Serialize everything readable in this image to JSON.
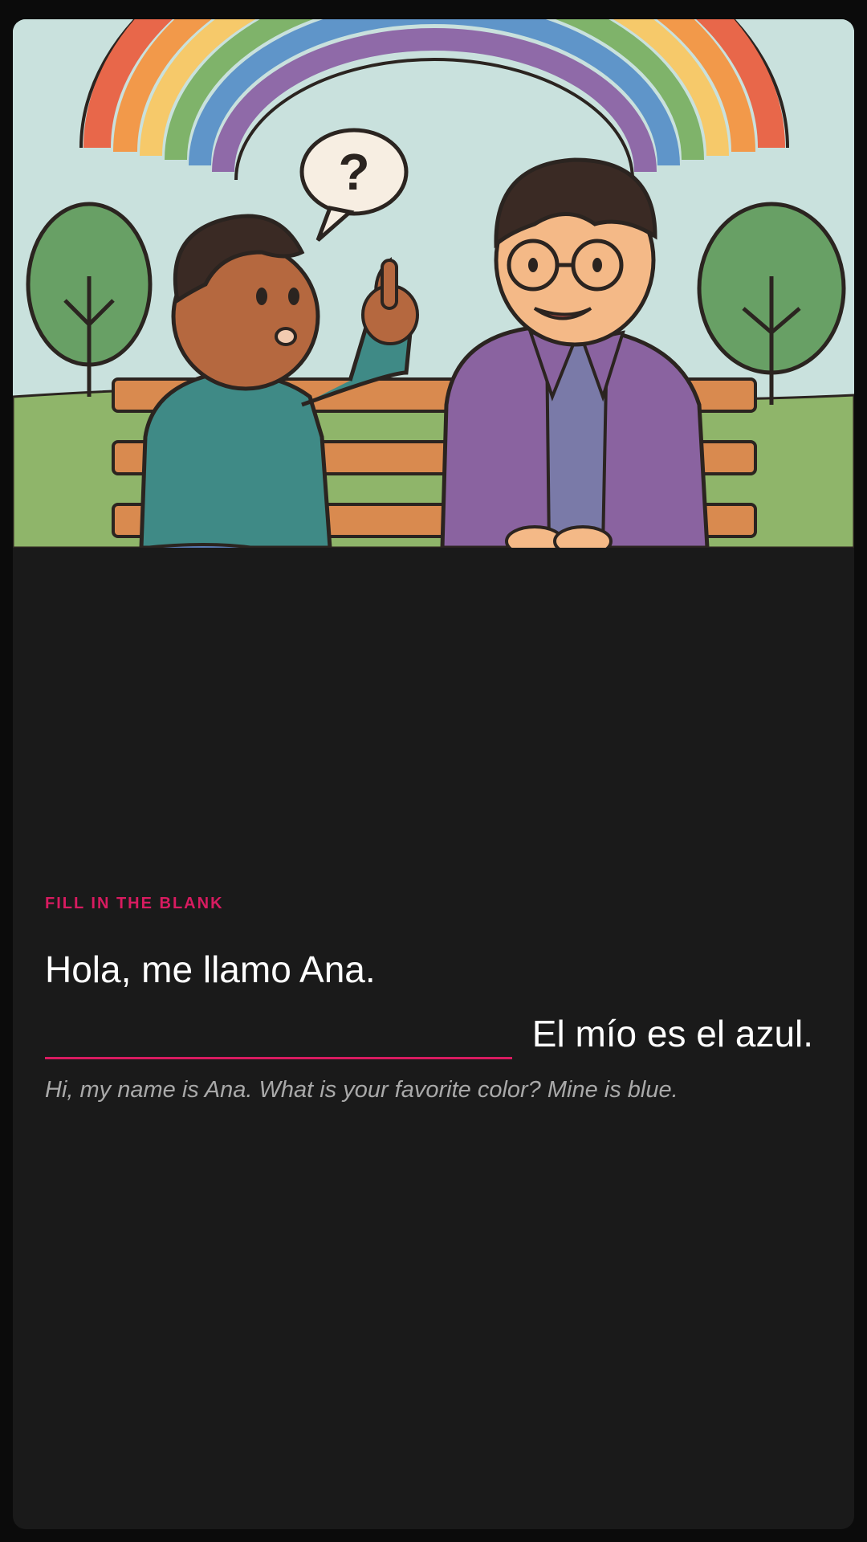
{
  "illustration": {
    "speech_bubble_text": "?",
    "description_icon": "kids-on-park-bench-rainbow-illustration",
    "colors": {
      "sky": "#c9e1dd",
      "grass": "#8fb56a",
      "bench": "#d98a4f",
      "teal_shirt": "#3f8a86",
      "purple_jacket": "#8a63a0"
    }
  },
  "exercise": {
    "label": "Fill in the blank",
    "sentence_before": "Hola, me llamo Ana.",
    "blank_value": "",
    "sentence_after": "El mío es el azul.",
    "translation": "Hi, my name is Ana. What is your favorite color? Mine is blue."
  },
  "colors": {
    "accent": "#d81b60",
    "background": "#1a1a1a",
    "text": "#ffffff",
    "muted_text": "#a9a9a9"
  }
}
